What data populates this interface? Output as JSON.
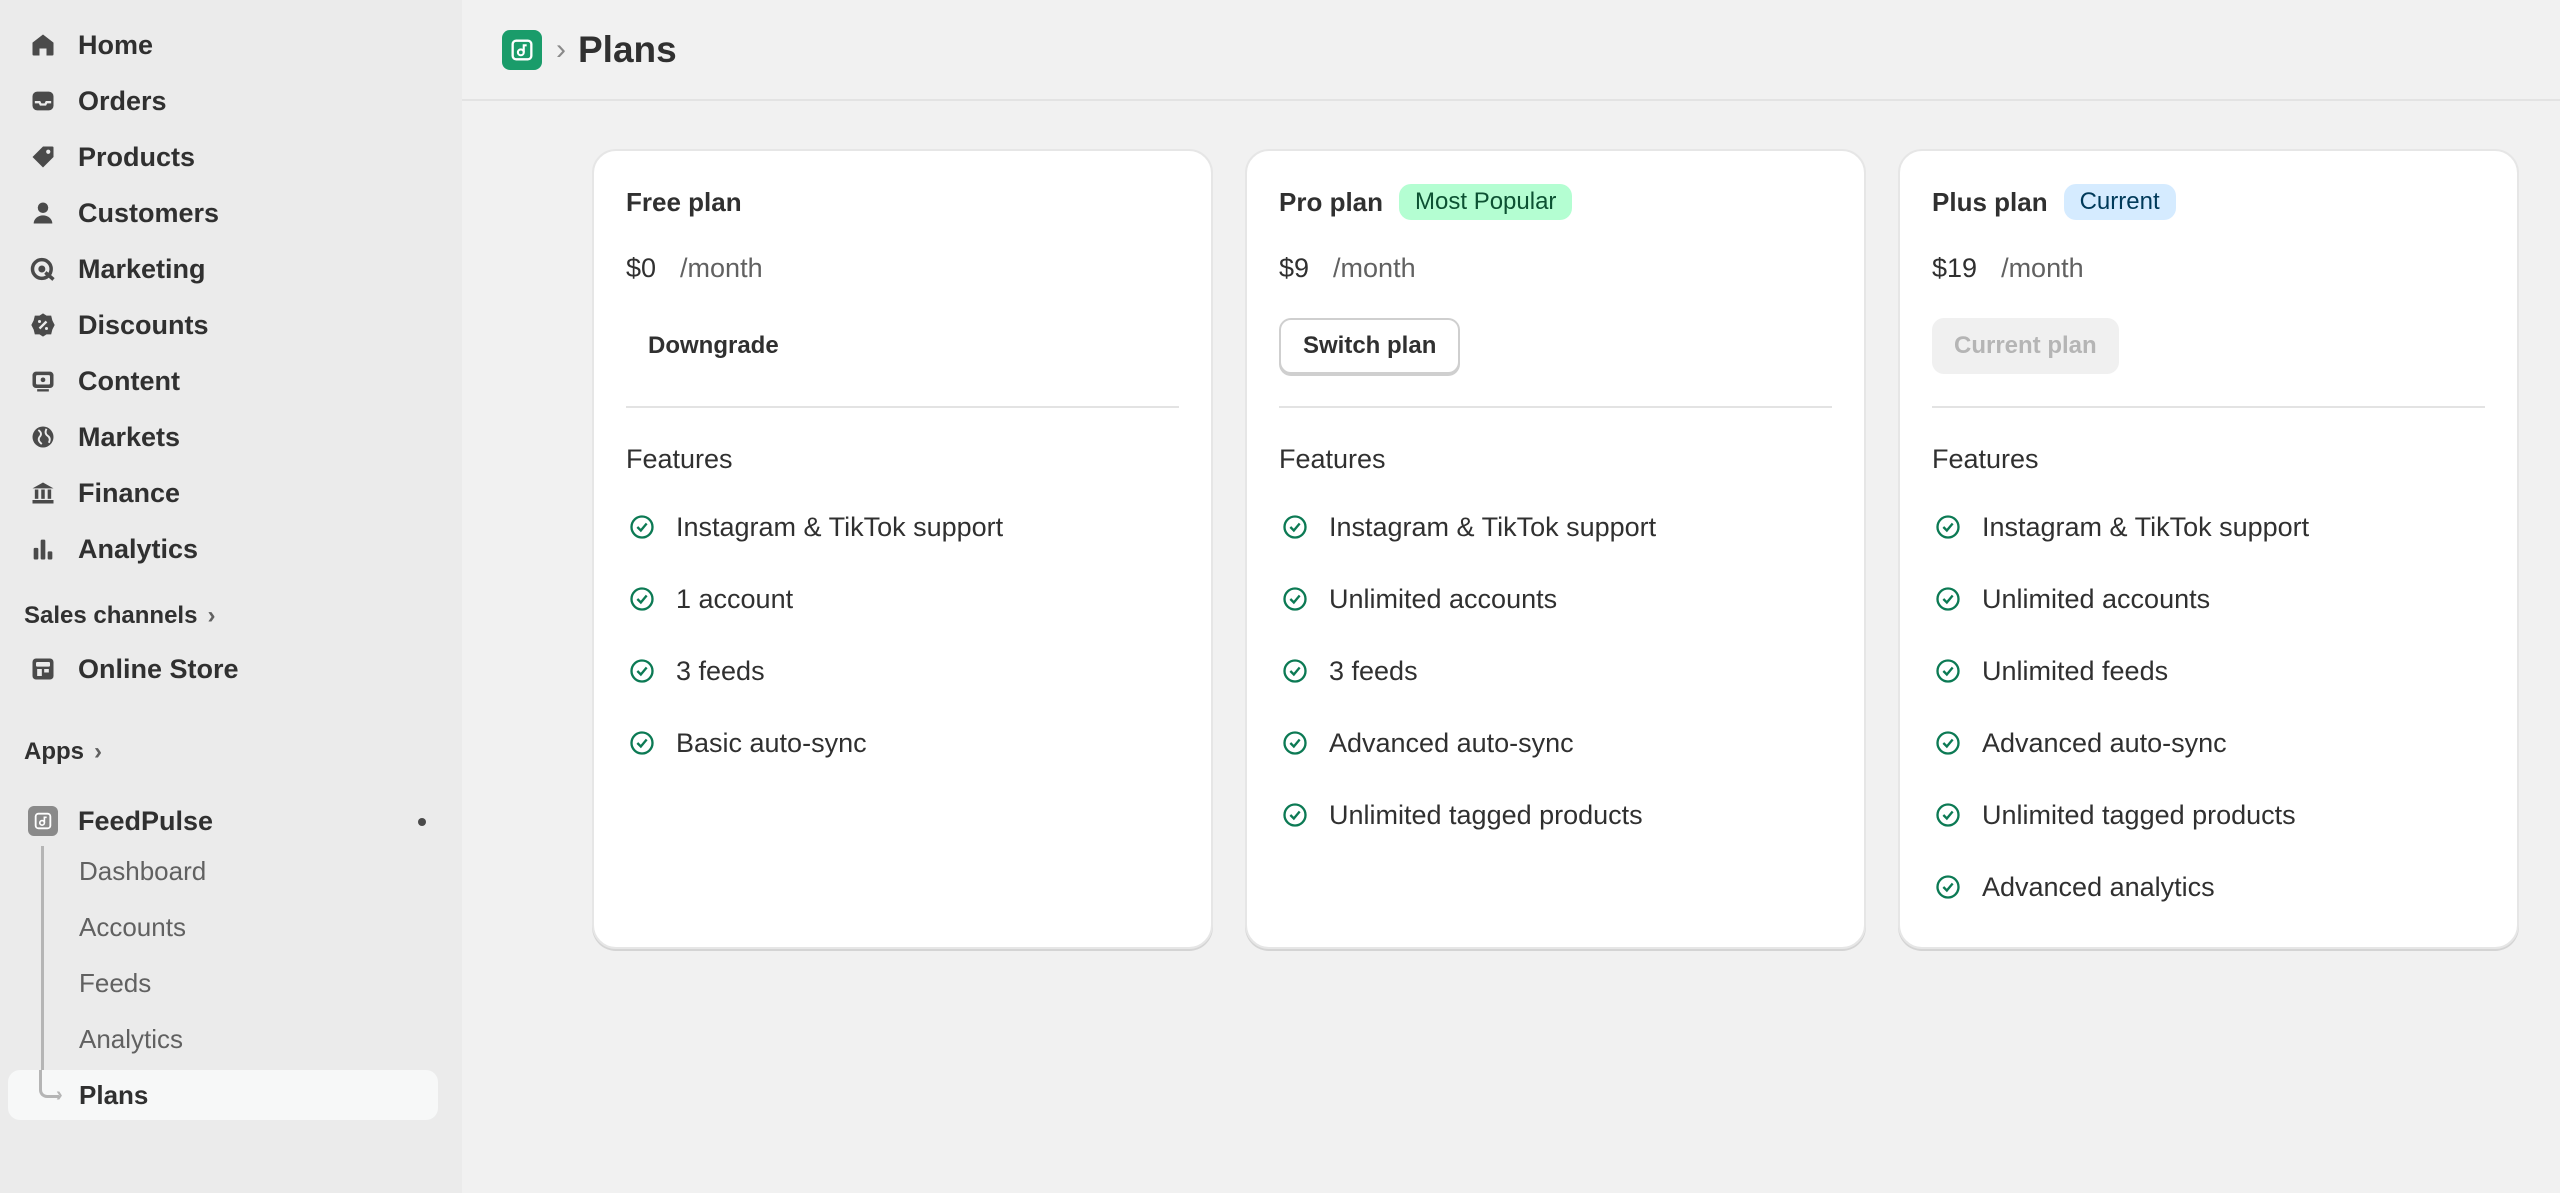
{
  "sidebar": {
    "nav": [
      {
        "label": "Home",
        "icon": "home-icon"
      },
      {
        "label": "Orders",
        "icon": "inbox-icon"
      },
      {
        "label": "Products",
        "icon": "tag-icon"
      },
      {
        "label": "Customers",
        "icon": "person-icon"
      },
      {
        "label": "Marketing",
        "icon": "target-icon"
      },
      {
        "label": "Discounts",
        "icon": "discount-icon"
      },
      {
        "label": "Content",
        "icon": "image-icon"
      },
      {
        "label": "Markets",
        "icon": "globe-icon"
      },
      {
        "label": "Finance",
        "icon": "bank-icon"
      },
      {
        "label": "Analytics",
        "icon": "bar-chart-icon"
      }
    ],
    "sales_channels_label": "Sales channels",
    "online_store_label": "Online Store",
    "apps_label": "Apps",
    "app_name": "FeedPulse",
    "sub_items": [
      "Dashboard",
      "Accounts",
      "Feeds",
      "Analytics",
      "Plans"
    ]
  },
  "header": {
    "title": "Plans"
  },
  "plans": [
    {
      "name": "Free plan",
      "badge": "",
      "price": "$0",
      "period": "/month",
      "button": "Downgrade",
      "features_title": "Features",
      "features": [
        "Instagram & TikTok support",
        "1 account",
        "3 feeds",
        "Basic auto-sync"
      ]
    },
    {
      "name": "Pro plan",
      "badge": "Most Popular",
      "price": "$9",
      "period": "/month",
      "button": "Switch plan",
      "features_title": "Features",
      "features": [
        "Instagram & TikTok support",
        "Unlimited accounts",
        "3 feeds",
        "Advanced auto-sync",
        "Unlimited tagged products"
      ]
    },
    {
      "name": "Plus plan",
      "badge": "Current",
      "price": "$19",
      "period": "/month",
      "button": "Current plan",
      "features_title": "Features",
      "features": [
        "Instagram & TikTok support",
        "Unlimited accounts",
        "Unlimited feeds",
        "Advanced auto-sync",
        "Unlimited tagged products",
        "Advanced analytics"
      ]
    }
  ],
  "colors": {
    "brand_green": "#1a9c6a",
    "check_green": "#0c7a54",
    "badge_popular_bg": "#b4fed2",
    "badge_current_bg": "#d5ebff"
  }
}
